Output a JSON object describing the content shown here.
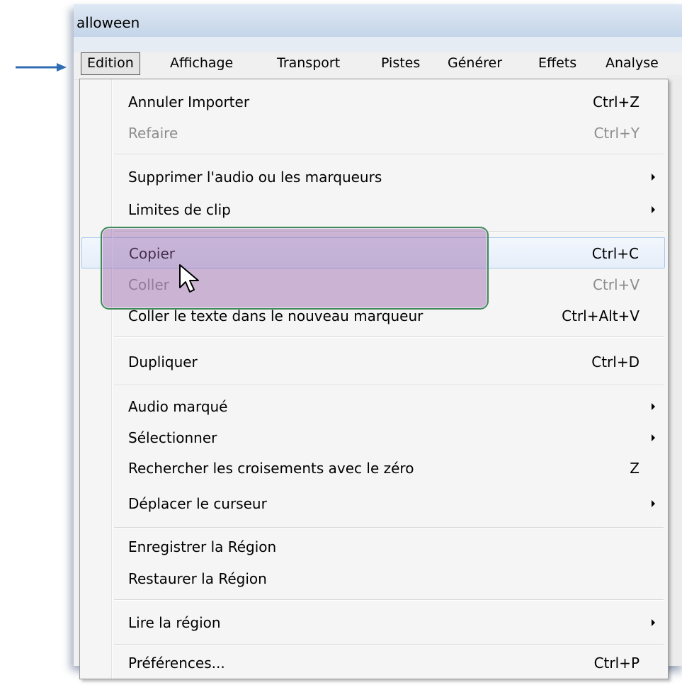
{
  "window": {
    "title": "alloween"
  },
  "menubar": {
    "items": [
      {
        "label": "Edition",
        "active": true
      },
      {
        "label": "Affichage"
      },
      {
        "label": "Transport"
      },
      {
        "label": "Pistes"
      },
      {
        "label": "Générer"
      },
      {
        "label": "Effets"
      },
      {
        "label": "Analyse"
      }
    ]
  },
  "menu": {
    "items": [
      {
        "label": "Annuler Importer",
        "shortcut": "Ctrl+Z",
        "enabled": true
      },
      {
        "label": "Refaire",
        "shortcut": "Ctrl+Y",
        "enabled": false
      },
      {
        "label": "Supprimer l'audio ou les marqueurs",
        "submenu": true,
        "enabled": true
      },
      {
        "label": "Limites de clip",
        "submenu": true,
        "enabled": true
      },
      {
        "label": "Copier",
        "shortcut": "Ctrl+C",
        "enabled": true,
        "hover": true
      },
      {
        "label": "Coller",
        "shortcut": "Ctrl+V",
        "enabled": false
      },
      {
        "label": "Coller le texte dans le nouveau marqueur",
        "shortcut": "Ctrl+Alt+V",
        "enabled": true
      },
      {
        "label": "Dupliquer",
        "shortcut": "Ctrl+D",
        "enabled": true
      },
      {
        "label": "Audio marqué",
        "submenu": true,
        "enabled": true
      },
      {
        "label": "Sélectionner",
        "submenu": true,
        "enabled": true
      },
      {
        "label": "Rechercher les croisements avec le zéro",
        "shortcut": "Z",
        "enabled": true
      },
      {
        "label": "Déplacer le curseur",
        "submenu": true,
        "enabled": true
      },
      {
        "label": "Enregistrer la Région",
        "enabled": true
      },
      {
        "label": "Restaurer la Région",
        "enabled": true
      },
      {
        "label": "Lire la région",
        "submenu": true,
        "enabled": true
      },
      {
        "label": "Préférences...",
        "shortcut": "Ctrl+P",
        "enabled": true
      }
    ]
  },
  "colors": {
    "highlight_fill": "#9664aa",
    "highlight_border": "#3f8a5a",
    "arrow": "#2f6db5",
    "disabled_text": "#8d8d8d"
  }
}
